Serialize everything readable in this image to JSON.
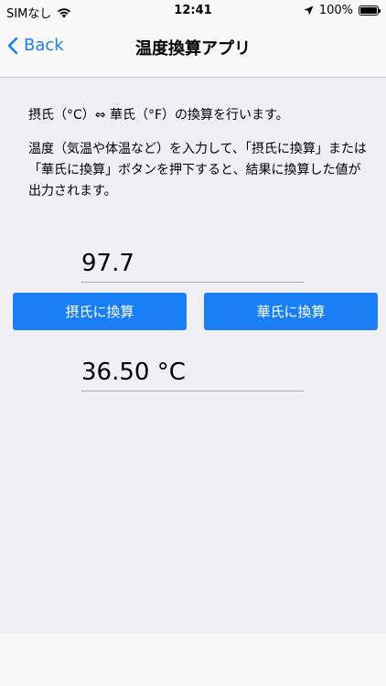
{
  "status_bar": {
    "carrier": "SIMなし",
    "time": "12:41",
    "battery": "100%",
    "battery_level": 1.0
  },
  "nav": {
    "back_label": "Back",
    "title": "温度換算アプリ"
  },
  "description": {
    "line1": "摂氏（°C）⇔ 華氏（°F）の換算を行います。",
    "line2": "温度（気温や体温など）を入力して、「摂氏に換算」または「華氏に換算」ボタンを押下すると、結果に換算した値が出力されます。"
  },
  "input": {
    "value": "97.7"
  },
  "buttons": {
    "to_celsius": "摂氏に換算",
    "to_fahrenheit": "華氏に換算"
  },
  "output": {
    "value": "36.50 °C"
  },
  "colors": {
    "accent": "#1a7ff5",
    "background": "#efeff4"
  },
  "icons": [
    "wifi-icon",
    "location-arrow-icon",
    "battery-icon",
    "chevron-left-icon"
  ]
}
